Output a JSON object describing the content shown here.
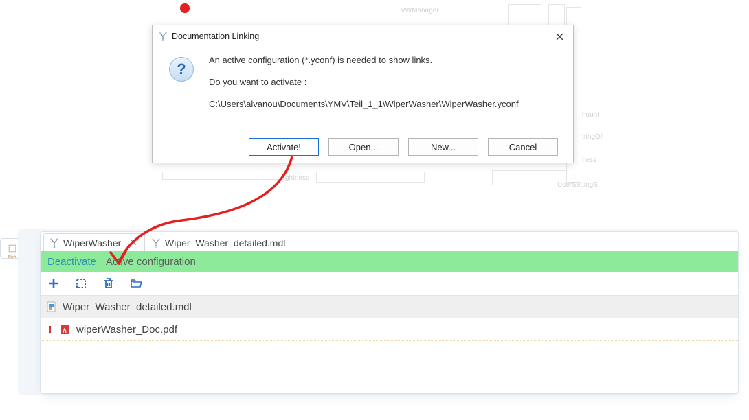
{
  "dialog": {
    "title": "Documentation Linking",
    "message_line1": "An active configuration (*.yconf) is needed to show links.",
    "message_line2": "Do you want to activate :",
    "path": "C:\\Users\\alvanou\\Documents\\YMV\\Teil_1_1\\WiperWasher\\WiperWasher.yconf",
    "buttons": {
      "activate": "Activate!",
      "open": "Open...",
      "new": "New...",
      "cancel": "Cancel"
    }
  },
  "editor": {
    "tabs": [
      {
        "label": "WiperWasher",
        "active": true,
        "closable": true
      },
      {
        "label": "Wiper_Washer_detailed.mdl",
        "active": false,
        "closable": false
      }
    ],
    "status": {
      "deactivate": "Deactivate",
      "active_conf": "Active configuration"
    },
    "files": [
      {
        "name": "Wiper_Washer_detailed.mdl",
        "kind": "mdl",
        "warn": false,
        "highlight": true
      },
      {
        "name": "wiperWasher_Doc.pdf",
        "kind": "pdf",
        "warn": true,
        "highlight": false
      }
    ]
  },
  "left_notch_text": "tio",
  "bg_fragments": {
    "a": "VWManager",
    "b": "hount",
    "c": "ttingOf",
    "d": "hess",
    "e": "UserSettingS",
    "f": "ghtness"
  }
}
